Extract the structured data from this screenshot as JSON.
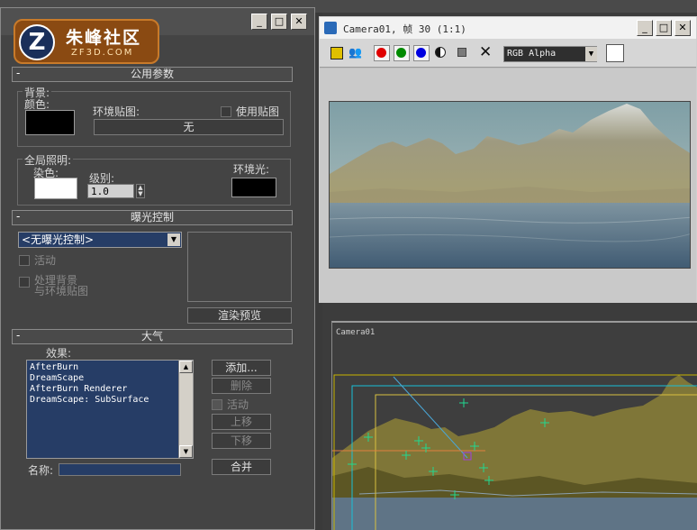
{
  "env_dialog": {
    "logo": {
      "name": "朱峰社区",
      "url": "ZF3D.COM",
      "mark": "Z"
    },
    "common": {
      "title": "公用参数",
      "background_label": "背景:",
      "color_label": "颜色:",
      "env_map_label": "环境贴图:",
      "use_map_label": "使用贴图",
      "env_map_button": "无",
      "global_light_label": "全局照明:",
      "tint_label": "染色:",
      "level_label": "级别:",
      "level_value": "1.0",
      "ambient_label": "环境光:",
      "background_color": "#000000",
      "tint_color": "#ffffff",
      "ambient_color": "#000000"
    },
    "exposure": {
      "title": "曝光控制",
      "select_value": "<无曝光控制>",
      "active_label": "活动",
      "process_bg_label_1": "处理背景",
      "process_bg_label_2": "与环境贴图",
      "render_preview_button": "渲染预览"
    },
    "atmosphere": {
      "title": "大气",
      "effects_label": "效果:",
      "effects": [
        "AfterBurn",
        "DreamScape",
        "AfterBurn Renderer",
        "DreamScape: SubSurface"
      ],
      "add_button": "添加...",
      "delete_button": "删除",
      "active_label": "活动",
      "move_up_button": "上移",
      "move_down_button": "下移",
      "name_label": "名称:",
      "merge_button": "合并"
    }
  },
  "camera_window": {
    "title": "Camera01, 帧 30 (1:1)",
    "channel": "RGB Alpha"
  },
  "viewport": {
    "label": "Camera01"
  },
  "colors": {
    "accent_blue": "#263d66",
    "panel": "#444444"
  }
}
